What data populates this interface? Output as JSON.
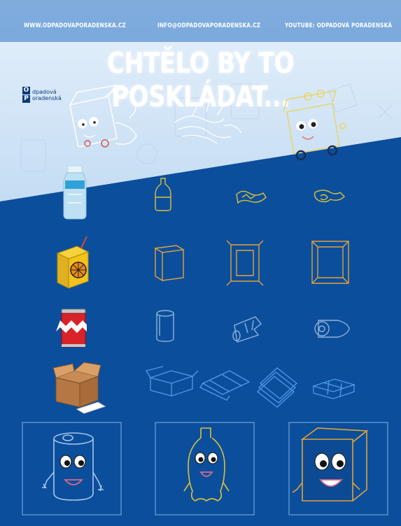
{
  "header": {
    "website": "WWW.ODPADOVAPORADENSKA.CZ",
    "email": "INFO@ODPADOVAPORADENSKA.CZ",
    "youtube": "YOUTUBE: ODPADOVÁ PORADENSKÁ"
  },
  "title": "CHTĚLO BY TO POSKLÁDAT...",
  "logo": {
    "mark_top": "O",
    "mark_bottom": "P",
    "line1": "dpadová",
    "line2": "oradenská"
  },
  "colors": {
    "background_blue": "#0b4e9c",
    "light_band": "#cfe3f6",
    "sketch_white": "#dfefff",
    "sketch_yellow": "#d9c23a",
    "sketch_orange": "#e3a23a",
    "sketch_blue": "#4f9be6",
    "sketch_gray": "#9fb6cf"
  },
  "rows": [
    {
      "item": "plastic-bottle",
      "steps": [
        "bottle-outline",
        "bottle-crushed",
        "bottle-folded"
      ]
    },
    {
      "item": "juice-carton",
      "steps": [
        "carton-box",
        "carton-flattening",
        "carton-flat"
      ]
    },
    {
      "item": "soda-can",
      "steps": [
        "can-outline",
        "can-crushed",
        "can-flattened"
      ]
    },
    {
      "item": "cardboard-box",
      "steps": [
        "box-unfolding",
        "box-flat",
        "sheets-stacked",
        "sheets-tied"
      ]
    }
  ],
  "characters": [
    "can-character",
    "bottle-character",
    "carton-character"
  ]
}
